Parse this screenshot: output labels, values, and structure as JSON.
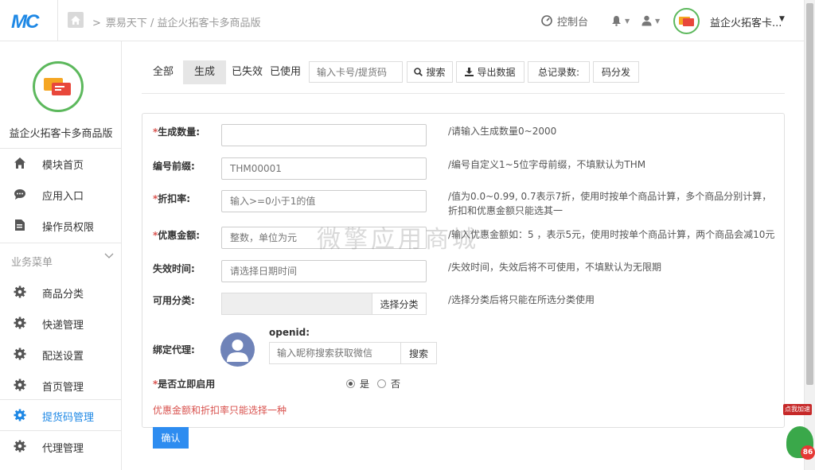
{
  "app": {
    "logo_text": "MC",
    "breadcrumb": "票易天下 / 益企火拓客卡多商品版",
    "dashboard_label": "控制台",
    "account_name": "益企火拓客卡...",
    "accent_color": "#2d8cf0"
  },
  "sidebar": {
    "title": "益企火拓客卡多商品版",
    "top_items": [
      {
        "label": "模块首页",
        "icon": "home-icon"
      },
      {
        "label": "应用入口",
        "icon": "chat-icon"
      },
      {
        "label": "操作员权限",
        "icon": "document-icon"
      }
    ],
    "group_label": "业务菜单",
    "group_items": [
      {
        "label": "商品分类",
        "icon": "gear-icon"
      },
      {
        "label": "快递管理",
        "icon": "gear-icon"
      },
      {
        "label": "配送设置",
        "icon": "gear-icon"
      },
      {
        "label": "首页管理",
        "icon": "gear-icon"
      },
      {
        "label": "提货码管理",
        "icon": "gear-icon",
        "active": true
      },
      {
        "label": "代理管理",
        "icon": "gear-icon"
      }
    ]
  },
  "toolbar": {
    "tabs": [
      "全部",
      "生成",
      "已失效",
      "已使用"
    ],
    "active_tab": "生成",
    "search_placeholder": "输入卡号/提货码",
    "search_button": "搜索",
    "export_button": "导出数据",
    "total_label": "总记录数:",
    "distribute_button": "码分发"
  },
  "form": {
    "quantity": {
      "label": "生成数量:",
      "value": "",
      "hint": "/请输入生成数量0~2000"
    },
    "prefix": {
      "label": "编号前缀:",
      "placeholder": "THM00001",
      "hint": "/编号自定义1~5位字母前缀，不填默认为THM"
    },
    "discount": {
      "label": "折扣率:",
      "placeholder": "输入>=0小于1的值",
      "hint_line1": "/值为0.0~0.99, 0.7表示7折，使用时按单个商品计算，多个商品分别计算，",
      "hint_line2": "折扣和优惠金额只能选其一"
    },
    "coupon": {
      "label": "优惠金额:",
      "placeholder": "整数，单位为元",
      "hint": "/输入优惠金额如：5 ，表示5元，使用时按单个商品计算，两个商品会减10元"
    },
    "expire": {
      "label": "失效时间:",
      "placeholder": "请选择日期时间",
      "hint": "/失效时间，失效后将不可使用，不填默认为无限期"
    },
    "category": {
      "label": "可用分类:",
      "button": "选择分类",
      "hint": "/选择分类后将只能在所选分类使用"
    },
    "agent": {
      "label": "绑定代理:",
      "openid_label": "openid:",
      "placeholder": "输入昵称搜索获取微信",
      "button": "搜索"
    },
    "enable": {
      "label": "是否立即启用",
      "yes": "是",
      "no": "否",
      "selected": "是"
    },
    "warning": "优惠金额和折扣率只能选择一种",
    "confirm": "确认"
  },
  "watermark": "微擎应用商城",
  "float_badge": {
    "caption": "点我加速",
    "count": "86"
  }
}
